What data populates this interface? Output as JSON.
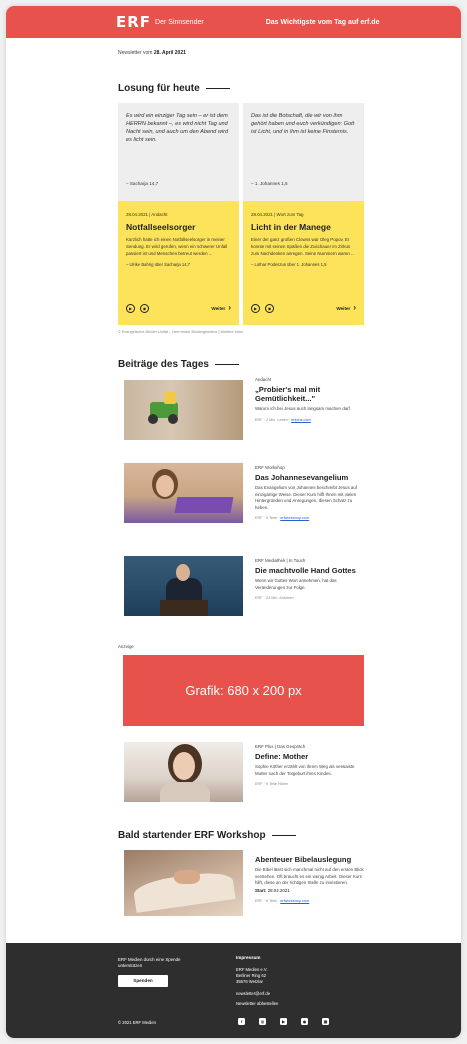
{
  "colors": {
    "brand_red": "#e8524c",
    "yellow": "#fde35a",
    "footer_bg": "#2e2e2e",
    "link": "#2962c9"
  },
  "header": {
    "logo": "ERF",
    "logo_sub": "Der Sinnsender",
    "tagline": "Das Wichtigste vom Tag auf erf.de"
  },
  "newsletter_date": {
    "prefix": "Newsletter vom ",
    "date": "28. April 2021"
  },
  "losung": {
    "title": "Losung für heute",
    "quotes": [
      {
        "text": "Es wird ein einziger Tag sein – er ist dem HERRN bekannt –, es wird nicht Tag und Nacht sein, und auch um den Abend wird es licht sein.",
        "ref": "– Sacharja 14,7"
      },
      {
        "text": "Das ist die Botschaft, die wir von ihm gehört haben und euch verkündigen: Gott ist Licht, und in ihm ist keine Finsternis.",
        "ref": "– 1. Johannes 1,5"
      }
    ],
    "cards": [
      {
        "meta": "28.04.2021 | Andacht",
        "title": "Notfallseelsorger",
        "text": "Kürzlich hatte ich einen Notfallseelsorger in meiner Sendung. Er wird gerufen, wenn ein schwerer Unfall passiert ist und Menschen betreut werden ...",
        "author": "– Ulrike Bahrig über Sacharja 14,7",
        "more": "Weiter"
      },
      {
        "meta": "28.04.2021 | Wort zum Tag",
        "title": "Licht in der Manege",
        "text": "Einer der ganz großen Clowns war Oleg Popov. Er konnte mit seinen Späßen die Zuschauer im Zirkus zum Nachdenken anregen. Seine Nummern waren ...",
        "author": "– Lothar Podeszus über 1. Johannes 1,5",
        "more": "Weiter"
      }
    ],
    "note": "© Evangelische Brüder-Unität – Herrnhuter Brüdergemeine | Weitere Infos"
  },
  "beitraege": {
    "title": "Beiträge des Tages",
    "items": [
      {
        "category": "Andacht",
        "title": "„Probier's mal mit Gemütlichkeit...\"",
        "desc": "Warum ich bei Jesus auch langsam machen darf.",
        "meta": "ERF · 2 Min. Lesen · ",
        "link": "erfplus.com"
      },
      {
        "category": "ERF Workshop",
        "title": "Das Johannesevangelium",
        "desc": "Das Evangelium von Johannes beschreibt Jesus auf einzigartige Weise. Dieser Kurs hilft Ihnen mit vielen Hintergründen und Anregungen, diesen Schatz zu heben.",
        "meta": "ERF · 5 Teile · ",
        "link": "erfworkshop.com"
      },
      {
        "category": "ERF Mediathek | In Touch",
        "title": "Die machtvolle Hand Gottes",
        "desc": "Wenn wir Gottes Wort annehmen, hat das Veränderungen zur Folge.",
        "meta": "ERF · 24 Min. Anhören",
        "link": ""
      }
    ]
  },
  "anzeige": {
    "label": "Anzeige",
    "banner": "Grafik: 680 x 200 px"
  },
  "extra": {
    "category": "ERF Plus | Das Gespräch",
    "title": "Define: Mother",
    "desc": "Sophie Köther erzählt von ihrem Weg als verwaiste Mutter nach der Totgeburt ihres Kindes.",
    "meta": "ERF · 9 Teile Hören"
  },
  "workshop": {
    "title": "Bald startender ERF Workshop",
    "item_title": "Abenteuer Bibelauslegung",
    "desc": "Die Bibel lässt sich manchmal nicht auf den ersten Blick verstehen. Oft braucht es ein wenig Arbeit. Dieser Kurs hilft, diese an der richtigen Stelle zu investieren.",
    "start_label": "Start:",
    "start_date": "28.04.2021",
    "meta": "ERF · 6 Teile · ",
    "link": "erfworkshop.com"
  },
  "footer": {
    "donate_text": "ERF Medien durch eine Spende unterstützen",
    "donate_button": "Spenden",
    "impressum_label": "Impressum",
    "address_1": "ERF Medien e.V.",
    "address_2": "Berliner Ring 62",
    "address_3": "35576 Wetzlar",
    "email": "newsletter@erf.de",
    "unsubscribe": "Newsletter abbestellen",
    "copyright": "© 2021 ERF Medien",
    "social_icons": [
      "facebook-icon",
      "instagram-icon",
      "youtube-icon",
      "podcast-icon",
      "app-icon"
    ]
  }
}
